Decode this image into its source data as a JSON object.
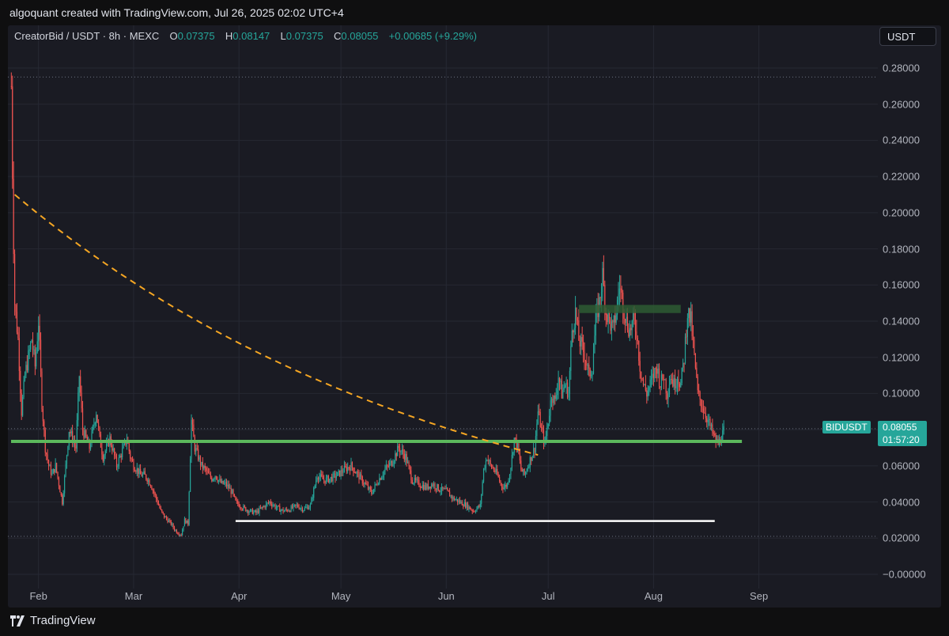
{
  "header": {
    "text": "algoquant created with TradingView.com, Jul 26, 2025 02:02 UTC+4"
  },
  "legend": {
    "symbol": "CreatorBid / USDT · 8h · MEXC",
    "o_label": "O",
    "o_value": "0.07375",
    "h_label": "H",
    "h_value": "0.08147",
    "l_label": "L",
    "l_value": "0.07375",
    "c_label": "C",
    "c_value": "0.08055",
    "change": "+0.00685 (+9.29%)"
  },
  "currency_button": "USDT",
  "price_badge": {
    "symbol": "BIDUSDT",
    "price": "0.08055",
    "countdown": "01:57:20"
  },
  "footer": {
    "brand": "TradingView"
  },
  "colors": {
    "up": "#26a69a",
    "down": "#ef5350",
    "support": "#5cb85c",
    "resistance": "#2e5a32",
    "curve": "#f5a623",
    "floor": "#ffffff",
    "background": "#1a1b23"
  },
  "chart_data": {
    "type": "candlestick",
    "interval": "8h",
    "exchange": "MEXC",
    "y_ticks": [
      "0.28000",
      "0.26000",
      "0.24000",
      "0.22000",
      "0.20000",
      "0.18000",
      "0.16000",
      "0.14000",
      "0.12000",
      "0.10000",
      "0.08000",
      "0.06000",
      "0.04000",
      "0.02000",
      "−0.00000"
    ],
    "y_range": [
      0,
      0.28
    ],
    "x_ticks": [
      "Feb",
      "Mar",
      "Apr",
      "May",
      "Jun",
      "Jul",
      "Aug",
      "Sep"
    ],
    "x_range_days": [
      -9,
      247
    ],
    "x_tick_days": [
      0,
      28,
      59,
      89,
      120,
      150,
      181,
      212
    ],
    "x_epoch_note": "days from Feb 1, 2025",
    "dotted_levels": [
      0.275,
      0.021,
      0.08055
    ],
    "price_path": [
      [
        -8,
        0.27
      ],
      [
        -7.5,
        0.2
      ],
      [
        -7,
        0.15
      ],
      [
        -6,
        0.13
      ],
      [
        -5,
        0.09
      ],
      [
        -4,
        0.11
      ],
      [
        -3,
        0.12
      ],
      [
        -2,
        0.13
      ],
      [
        -1,
        0.115
      ],
      [
        0,
        0.14
      ],
      [
        1,
        0.095
      ],
      [
        2,
        0.07
      ],
      [
        3,
        0.06
      ],
      [
        4,
        0.055
      ],
      [
        5,
        0.06
      ],
      [
        6,
        0.05
      ],
      [
        7,
        0.04
      ],
      [
        8,
        0.06
      ],
      [
        9,
        0.08
      ],
      [
        10,
        0.075
      ],
      [
        11,
        0.07
      ],
      [
        12,
        0.11
      ],
      [
        13,
        0.08
      ],
      [
        14,
        0.075
      ],
      [
        15,
        0.07
      ],
      [
        16,
        0.08
      ],
      [
        17,
        0.09
      ],
      [
        18,
        0.075
      ],
      [
        19,
        0.065
      ],
      [
        20,
        0.07
      ],
      [
        21,
        0.075
      ],
      [
        22,
        0.068
      ],
      [
        23,
        0.06
      ],
      [
        24,
        0.065
      ],
      [
        25,
        0.07
      ],
      [
        26,
        0.075
      ],
      [
        27,
        0.065
      ],
      [
        28,
        0.06
      ],
      [
        29,
        0.058
      ],
      [
        30,
        0.055
      ],
      [
        31,
        0.055
      ],
      [
        32,
        0.053
      ],
      [
        33,
        0.05
      ],
      [
        34,
        0.045
      ],
      [
        35,
        0.04
      ],
      [
        36,
        0.035
      ],
      [
        37,
        0.032
      ],
      [
        38,
        0.03
      ],
      [
        39,
        0.028
      ],
      [
        40,
        0.025
      ],
      [
        41,
        0.023
      ],
      [
        42,
        0.022
      ],
      [
        43,
        0.03
      ],
      [
        44,
        0.028
      ],
      [
        45,
        0.085
      ],
      [
        46,
        0.07
      ],
      [
        47,
        0.065
      ],
      [
        48,
        0.06
      ],
      [
        49,
        0.058
      ],
      [
        50,
        0.055
      ],
      [
        51,
        0.053
      ],
      [
        52,
        0.055
      ],
      [
        53,
        0.052
      ],
      [
        54,
        0.05
      ],
      [
        55,
        0.05
      ],
      [
        56,
        0.048
      ],
      [
        57,
        0.045
      ],
      [
        58,
        0.04
      ],
      [
        60,
        0.037
      ],
      [
        62,
        0.035
      ],
      [
        64,
        0.034
      ],
      [
        66,
        0.037
      ],
      [
        68,
        0.04
      ],
      [
        70,
        0.037
      ],
      [
        72,
        0.035
      ],
      [
        74,
        0.036
      ],
      [
        76,
        0.038
      ],
      [
        78,
        0.036
      ],
      [
        80,
        0.038
      ],
      [
        82,
        0.055
      ],
      [
        84,
        0.052
      ],
      [
        86,
        0.053
      ],
      [
        88,
        0.055
      ],
      [
        90,
        0.058
      ],
      [
        92,
        0.06
      ],
      [
        94,
        0.055
      ],
      [
        96,
        0.05
      ],
      [
        98,
        0.045
      ],
      [
        100,
        0.052
      ],
      [
        102,
        0.058
      ],
      [
        104,
        0.062
      ],
      [
        106,
        0.07
      ],
      [
        108,
        0.065
      ],
      [
        110,
        0.052
      ],
      [
        112,
        0.05
      ],
      [
        114,
        0.048
      ],
      [
        116,
        0.05
      ],
      [
        118,
        0.047
      ],
      [
        120,
        0.046
      ],
      [
        122,
        0.042
      ],
      [
        124,
        0.04
      ],
      [
        126,
        0.038
      ],
      [
        128,
        0.035
      ],
      [
        130,
        0.038
      ],
      [
        131,
        0.058
      ],
      [
        132,
        0.065
      ],
      [
        133,
        0.06
      ],
      [
        134,
        0.058
      ],
      [
        135,
        0.055
      ],
      [
        136,
        0.05
      ],
      [
        137,
        0.048
      ],
      [
        138,
        0.05
      ],
      [
        139,
        0.06
      ],
      [
        140,
        0.075
      ],
      [
        141,
        0.07
      ],
      [
        142,
        0.058
      ],
      [
        143,
        0.055
      ],
      [
        144,
        0.06
      ],
      [
        145,
        0.065
      ],
      [
        146,
        0.07
      ],
      [
        147,
        0.09
      ],
      [
        148,
        0.08
      ],
      [
        149,
        0.072
      ],
      [
        150,
        0.085
      ],
      [
        151,
        0.1
      ],
      [
        152,
        0.095
      ],
      [
        153,
        0.11
      ],
      [
        154,
        0.1
      ],
      [
        155,
        0.105
      ],
      [
        156,
        0.1
      ],
      [
        157,
        0.135
      ],
      [
        158,
        0.145
      ],
      [
        159,
        0.13
      ],
      [
        160,
        0.125
      ],
      [
        161,
        0.12
      ],
      [
        162,
        0.11
      ],
      [
        163,
        0.115
      ],
      [
        164,
        0.14
      ],
      [
        165,
        0.15
      ],
      [
        166,
        0.165
      ],
      [
        167,
        0.145
      ],
      [
        168,
        0.14
      ],
      [
        169,
        0.135
      ],
      [
        170,
        0.145
      ],
      [
        171,
        0.16
      ],
      [
        172,
        0.15
      ],
      [
        173,
        0.14
      ],
      [
        174,
        0.135
      ],
      [
        175,
        0.14
      ],
      [
        176,
        0.135
      ],
      [
        177,
        0.115
      ],
      [
        178,
        0.105
      ],
      [
        179,
        0.1
      ],
      [
        180,
        0.105
      ],
      [
        181,
        0.11
      ],
      [
        182,
        0.115
      ],
      [
        183,
        0.105
      ],
      [
        184,
        0.11
      ],
      [
        185,
        0.1
      ],
      [
        186,
        0.11
      ],
      [
        187,
        0.105
      ],
      [
        188,
        0.11
      ],
      [
        189,
        0.105
      ],
      [
        190,
        0.12
      ],
      [
        191,
        0.145
      ],
      [
        192,
        0.14
      ],
      [
        193,
        0.12
      ],
      [
        194,
        0.1
      ],
      [
        195,
        0.095
      ],
      [
        196,
        0.09
      ],
      [
        197,
        0.085
      ],
      [
        198,
        0.08
      ],
      [
        199,
        0.075
      ],
      [
        200,
        0.072
      ],
      [
        201,
        0.076
      ],
      [
        202,
        0.08055
      ]
    ],
    "annotations": [
      {
        "kind": "support-line",
        "from": [
          -9,
          0.0735
        ],
        "to": [
          207,
          0.0735
        ]
      },
      {
        "kind": "floor-line",
        "from": [
          58,
          0.0295
        ],
        "to": [
          199,
          0.0295
        ]
      },
      {
        "kind": "resistance-zone",
        "from": [
          159,
          0.1445
        ],
        "to": [
          189,
          0.149
        ]
      },
      {
        "kind": "decay-curve",
        "from": [
          -7,
          0.21
        ],
        "to": [
          147,
          0.066
        ]
      }
    ]
  }
}
